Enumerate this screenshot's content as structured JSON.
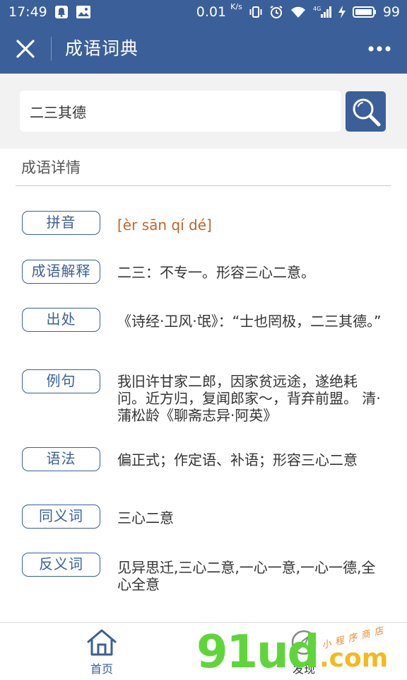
{
  "status_bar": {
    "time": "17:49",
    "network_speed": "0.01",
    "network_speed_unit": "K/s",
    "signal_label": "4G",
    "battery": "99"
  },
  "header": {
    "title": "成语词典"
  },
  "search": {
    "value": "二三其德"
  },
  "section": {
    "title": "成语详情"
  },
  "details": [
    {
      "label": "拼音",
      "text": "[èr sān qí dé]"
    },
    {
      "label": "成语解释",
      "text": "二三：不专一。形容三心二意。"
    },
    {
      "label": "出处",
      "text": "《诗经·卫风·氓》：“士也罔极，二三其德。”"
    },
    {
      "label": "例句",
      "text": "我旧许甘家二郎，因家贫远途，遂绝耗问。近方归，复闻郎家～，背弃前盟。 清·蒲松龄《聊斋志异·阿英》"
    },
    {
      "label": "语法",
      "text": "偏正式；作定语、补语；形容三心二意"
    },
    {
      "label": "同义词",
      "text": "三心二意"
    },
    {
      "label": "反义词",
      "text": "见异思迁,三心二意,一心一意,一心一德,全心全意"
    }
  ],
  "bottom_nav": {
    "home_label": "首页",
    "find_label": "发现"
  },
  "watermark": {
    "main": "91ud",
    "suffix": ".com",
    "tagline": "小程序商店"
  },
  "colors": {
    "primary": "#3b5f98",
    "pinyin": "#c0662a",
    "search_bg": "#f2f2f2"
  }
}
